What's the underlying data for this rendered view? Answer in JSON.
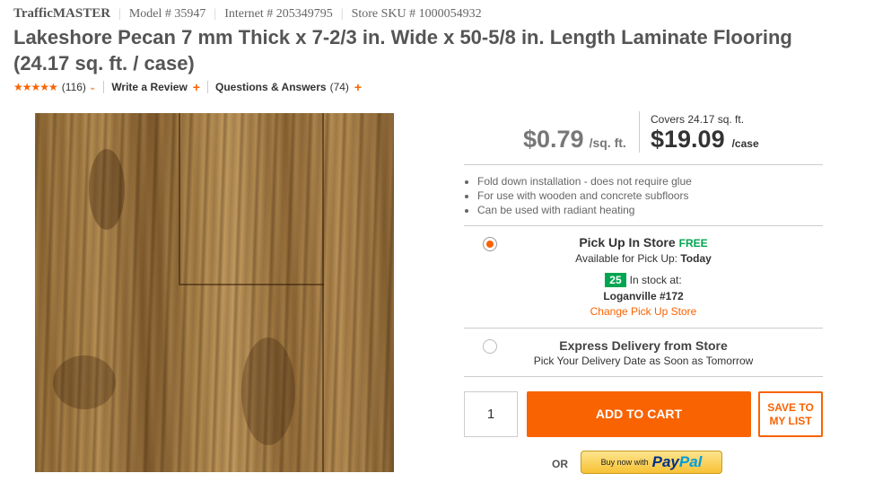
{
  "meta": {
    "brand": "TrafficMASTER",
    "model": "Model # 35947",
    "internet": "Internet # 205349795",
    "store_sku": "Store SKU # 1000054932"
  },
  "product": {
    "title": "Lakeshore Pecan 7 mm Thick x 7-2/3 in. Wide x 50-5/8 in. Length Laminate Flooring (24.17 sq. ft. / case)"
  },
  "reviews": {
    "stars": "★★★★★",
    "rating_of_5": 5,
    "count": "(116)",
    "write_review": "Write a Review",
    "qa": "Questions & Answers",
    "qa_count": "(74)",
    "plus": "+"
  },
  "pricing": {
    "unit_price": "$0.79",
    "unit_label": "/sq. ft.",
    "covers": "Covers 24.17 sq. ft.",
    "case_price": "$19.09",
    "case_label": "/case"
  },
  "features": [
    "Fold down installation - does not require glue",
    "For use with wooden and concrete subfloors",
    "Can be used with radiant heating"
  ],
  "pickup": {
    "selected": true,
    "title": "Pick Up In Store",
    "free": "FREE",
    "available_label": "Available for Pick Up:",
    "available_value": "Today",
    "stock_count": "25",
    "stock_label": "In stock at:",
    "store": "Loganville #172",
    "change": "Change Pick Up Store"
  },
  "express": {
    "selected": false,
    "title": "Express Delivery from Store",
    "subtitle": "Pick Your Delivery Date as Soon as Tomorrow"
  },
  "cart": {
    "quantity": "1",
    "add_to_cart": "ADD TO CART",
    "save_line1": "SAVE TO",
    "save_line2": "MY LIST",
    "or": "OR",
    "paypal_buy": "Buy now with",
    "paypal_pay": "Pay",
    "paypal_pal": "Pal"
  },
  "colors": {
    "accent": "#f96302",
    "stock_green": "#00a550"
  }
}
